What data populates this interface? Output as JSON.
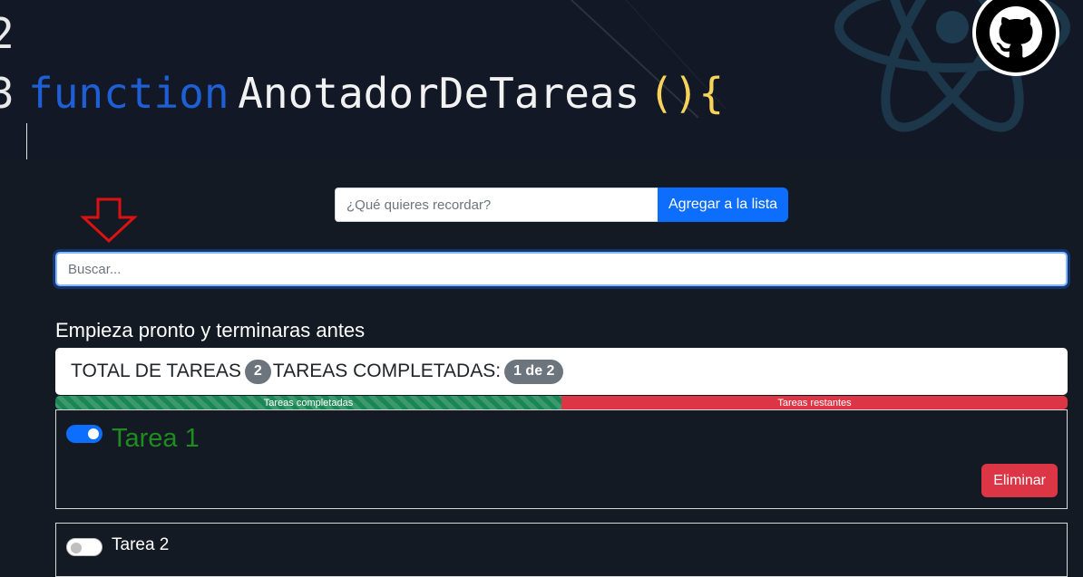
{
  "header": {
    "line_numbers": [
      "2",
      "3"
    ],
    "code_keyword": "function",
    "code_name": "AnotadorDeTareas",
    "code_parens": "(){",
    "github_icon": "github-icon",
    "background_icon": "react-logo-icon",
    "colors": {
      "keyword": "#1f5fd6",
      "parens": "#f7d35a"
    }
  },
  "add_task": {
    "placeholder": "¿Qué quieres recordar?",
    "value": "",
    "button_label": "Agregar a la lista"
  },
  "search": {
    "placeholder": "Buscar...",
    "value": "",
    "focused": true
  },
  "pointer_icon": "down-arrow-icon",
  "motto": "Empieza pronto y terminaras antes",
  "stats": {
    "total_label": "TOTAL DE TAREAS",
    "total_count": "2",
    "completed_label": "TAREAS COMPLETADAS:",
    "completed_badge": "1 de 2"
  },
  "progress": {
    "completed_label": "Tareas completadas",
    "remaining_label": "Tareas restantes",
    "completed_fraction": 0.5,
    "colors": {
      "completed": "#198754",
      "remaining": "#dc3545"
    }
  },
  "tasks": [
    {
      "title": "Tarea 1",
      "done": true,
      "delete_label": "Eliminar"
    },
    {
      "title": "Tarea 2",
      "done": false
    }
  ]
}
